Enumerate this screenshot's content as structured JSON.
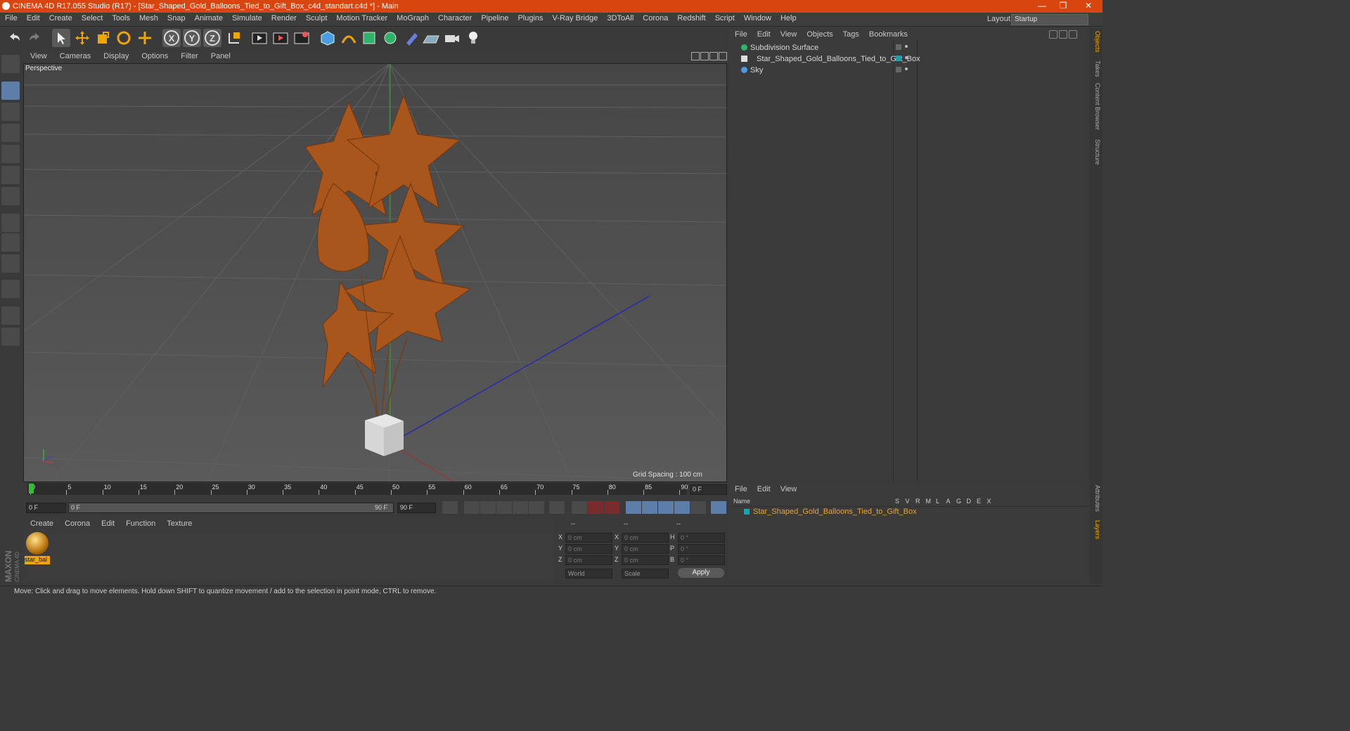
{
  "window": {
    "title": "CINEMA 4D R17.055 Studio (R17) - [Star_Shaped_Gold_Balloons_Tied_to_Gift_Box_c4d_standart.c4d *] - Main",
    "minimize": "—",
    "restore": "❐",
    "close": "✕"
  },
  "menu": [
    "File",
    "Edit",
    "Create",
    "Select",
    "Tools",
    "Mesh",
    "Snap",
    "Animate",
    "Simulate",
    "Render",
    "Sculpt",
    "Motion Tracker",
    "MoGraph",
    "Character",
    "Pipeline",
    "Plugins",
    "V-Ray Bridge",
    "3DToAll",
    "Corona",
    "Redshift",
    "Script",
    "Window",
    "Help"
  ],
  "layout": {
    "label": "Layout:",
    "value": "Startup"
  },
  "viewport": {
    "menu": [
      "View",
      "Cameras",
      "Display",
      "Options",
      "Filter",
      "Panel"
    ],
    "camera_label": "Perspective",
    "grid_spacing": "Grid Spacing : 100 cm"
  },
  "timeline": {
    "ticks": [
      "0",
      "5",
      "10",
      "15",
      "20",
      "25",
      "30",
      "35",
      "40",
      "45",
      "50",
      "55",
      "60",
      "65",
      "70",
      "75",
      "80",
      "85",
      "90"
    ],
    "current_frame": "0 F",
    "start_field": "0 F",
    "range_start": "0 F",
    "range_end": "90 F",
    "end_field": "90 F"
  },
  "materials": {
    "menu": [
      "Create",
      "Corona",
      "Edit",
      "Function",
      "Texture"
    ],
    "items": [
      {
        "label": "star_bal"
      }
    ]
  },
  "coordinates": {
    "headers": [
      "--",
      "--",
      "--"
    ],
    "rows": [
      {
        "a": "X",
        "av": "0 cm",
        "b": "X",
        "bv": "0 cm",
        "c": "H",
        "cv": "0 °"
      },
      {
        "a": "Y",
        "av": "0 cm",
        "b": "Y",
        "bv": "0 cm",
        "c": "P",
        "cv": "0 °"
      },
      {
        "a": "Z",
        "av": "0 cm",
        "b": "Z",
        "bv": "0 cm",
        "c": "B",
        "cv": "0 °"
      }
    ],
    "mode1": "World",
    "mode2": "Scale",
    "apply": "Apply"
  },
  "objects": {
    "menu": [
      "File",
      "Edit",
      "View",
      "Objects",
      "Tags",
      "Bookmarks"
    ],
    "rows": [
      {
        "name": "Subdivision Surface",
        "icon": "subdivision-icon"
      },
      {
        "name": "Star_Shaped_Gold_Balloons_Tied_to_Gift_Box",
        "icon": "null-object-icon"
      },
      {
        "name": "Sky",
        "icon": "sky-icon"
      }
    ]
  },
  "layers": {
    "menu": [
      "File",
      "Edit",
      "View"
    ],
    "columns": [
      "Name",
      "S",
      "V",
      "R",
      "M",
      "L",
      "A",
      "G",
      "D",
      "E",
      "X"
    ],
    "rows": [
      {
        "name": "Star_Shaped_Gold_Balloons_Tied_to_Gift_Box",
        "color": "#19a3b0"
      }
    ]
  },
  "right_tabs": [
    "Objects",
    "Takes",
    "Content Browser",
    "Structure",
    "Attributes",
    "Layers"
  ],
  "status": "Move: Click and drag to move elements. Hold down SHIFT to quantize movement / add to the selection in point mode, CTRL to remove.",
  "colors": {
    "accent": "#d9450f",
    "balloon": "#b35a1f",
    "layer": "#19a3b0",
    "highlight": "#e8a33b"
  }
}
